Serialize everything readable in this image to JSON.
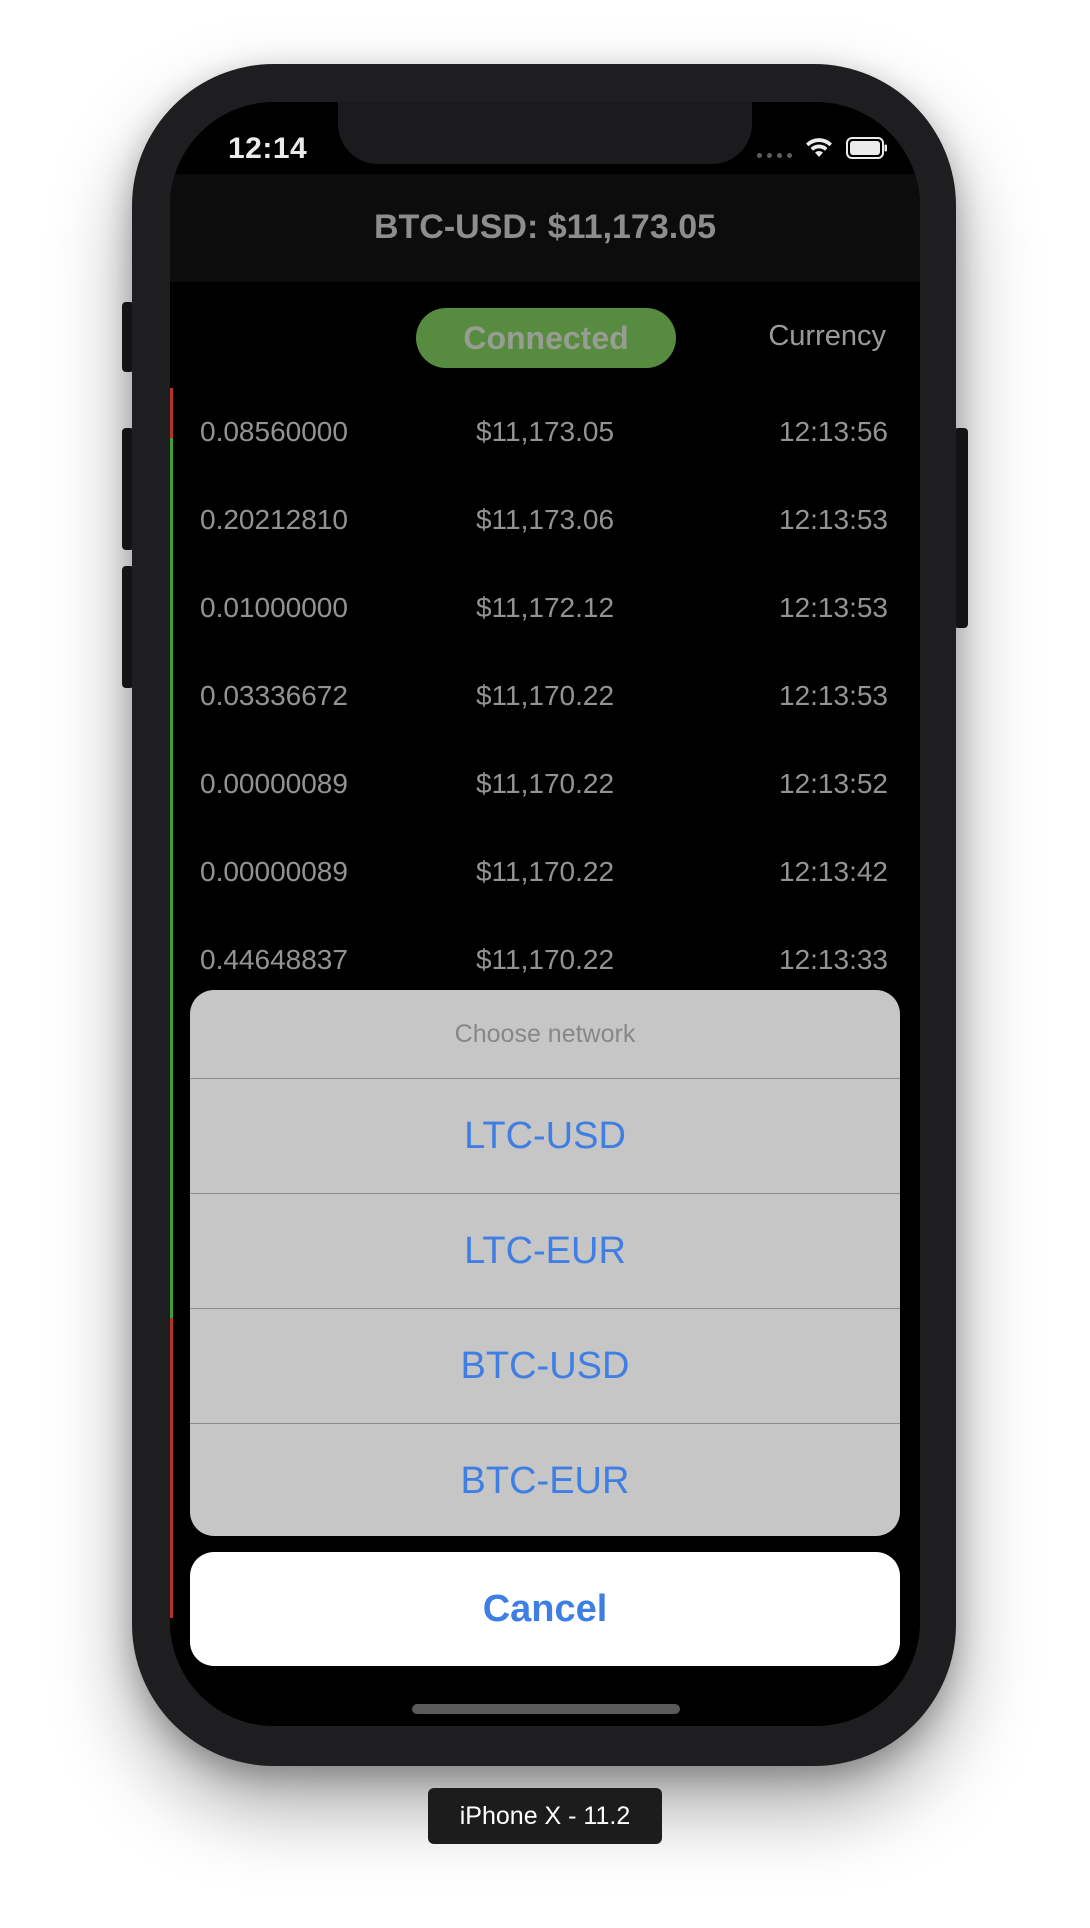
{
  "status_bar": {
    "time": "12:14"
  },
  "nav": {
    "title": "BTC-USD: $11,173.05"
  },
  "controls": {
    "status": "Connected",
    "currency_label": "Currency"
  },
  "trades": [
    {
      "size": "0.08560000",
      "price": "$11,173.05",
      "time": "12:13:56"
    },
    {
      "size": "0.20212810",
      "price": "$11,173.06",
      "time": "12:13:53"
    },
    {
      "size": "0.01000000",
      "price": "$11,172.12",
      "time": "12:13:53"
    },
    {
      "size": "0.03336672",
      "price": "$11,170.22",
      "time": "12:13:53"
    },
    {
      "size": "0.00000089",
      "price": "$11,170.22",
      "time": "12:13:52"
    },
    {
      "size": "0.00000089",
      "price": "$11,170.22",
      "time": "12:13:42"
    },
    {
      "size": "0.44648837",
      "price": "$11,170.22",
      "time": "12:13:33"
    }
  ],
  "action_sheet": {
    "title": "Choose network",
    "options": [
      "LTC-USD",
      "LTC-EUR",
      "BTC-USD",
      "BTC-EUR"
    ],
    "cancel": "Cancel"
  },
  "device_label": "iPhone X - 11.2",
  "colors": {
    "connected": "#5f9846",
    "action_tint": "#3f7fe3",
    "sheet_bg": "#c6c6c6",
    "trade_up": "#3fae3c",
    "trade_down": "#c0392b"
  }
}
